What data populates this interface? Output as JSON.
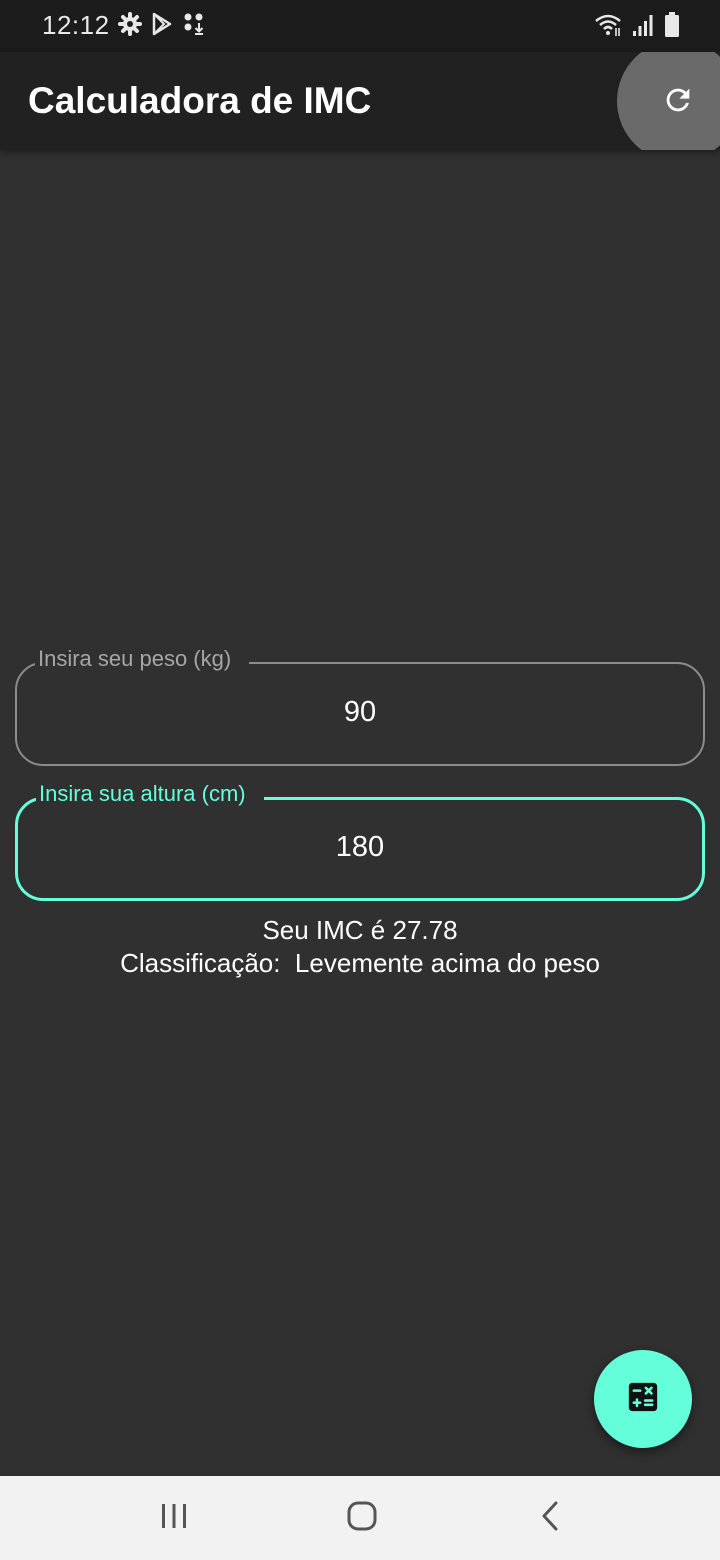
{
  "status_bar": {
    "time": "12:12",
    "left_icons": [
      "settings-icon",
      "play-store-icon",
      "download-notification-icon"
    ],
    "right_icons": [
      "wifi-icon",
      "signal-icon",
      "battery-icon"
    ]
  },
  "app_bar": {
    "title": "Calculadora de IMC",
    "action_icon": "refresh-icon"
  },
  "form": {
    "weight": {
      "label": "Insira seu peso (kg)",
      "value": "90"
    },
    "height": {
      "label": "Insira sua altura (cm)",
      "value": "180"
    }
  },
  "result": {
    "bmi_text": "Seu IMC é 27.78",
    "classification_text": "Classificação:  Levemente acima do peso"
  },
  "fab": {
    "icon": "calculator-icon"
  },
  "nav_bar": {
    "buttons": [
      "recent-apps-icon",
      "home-icon",
      "back-icon"
    ]
  },
  "colors": {
    "background": "#303030",
    "app_bar": "#212121",
    "accent": "#64ffda",
    "text": "#ffffff"
  }
}
